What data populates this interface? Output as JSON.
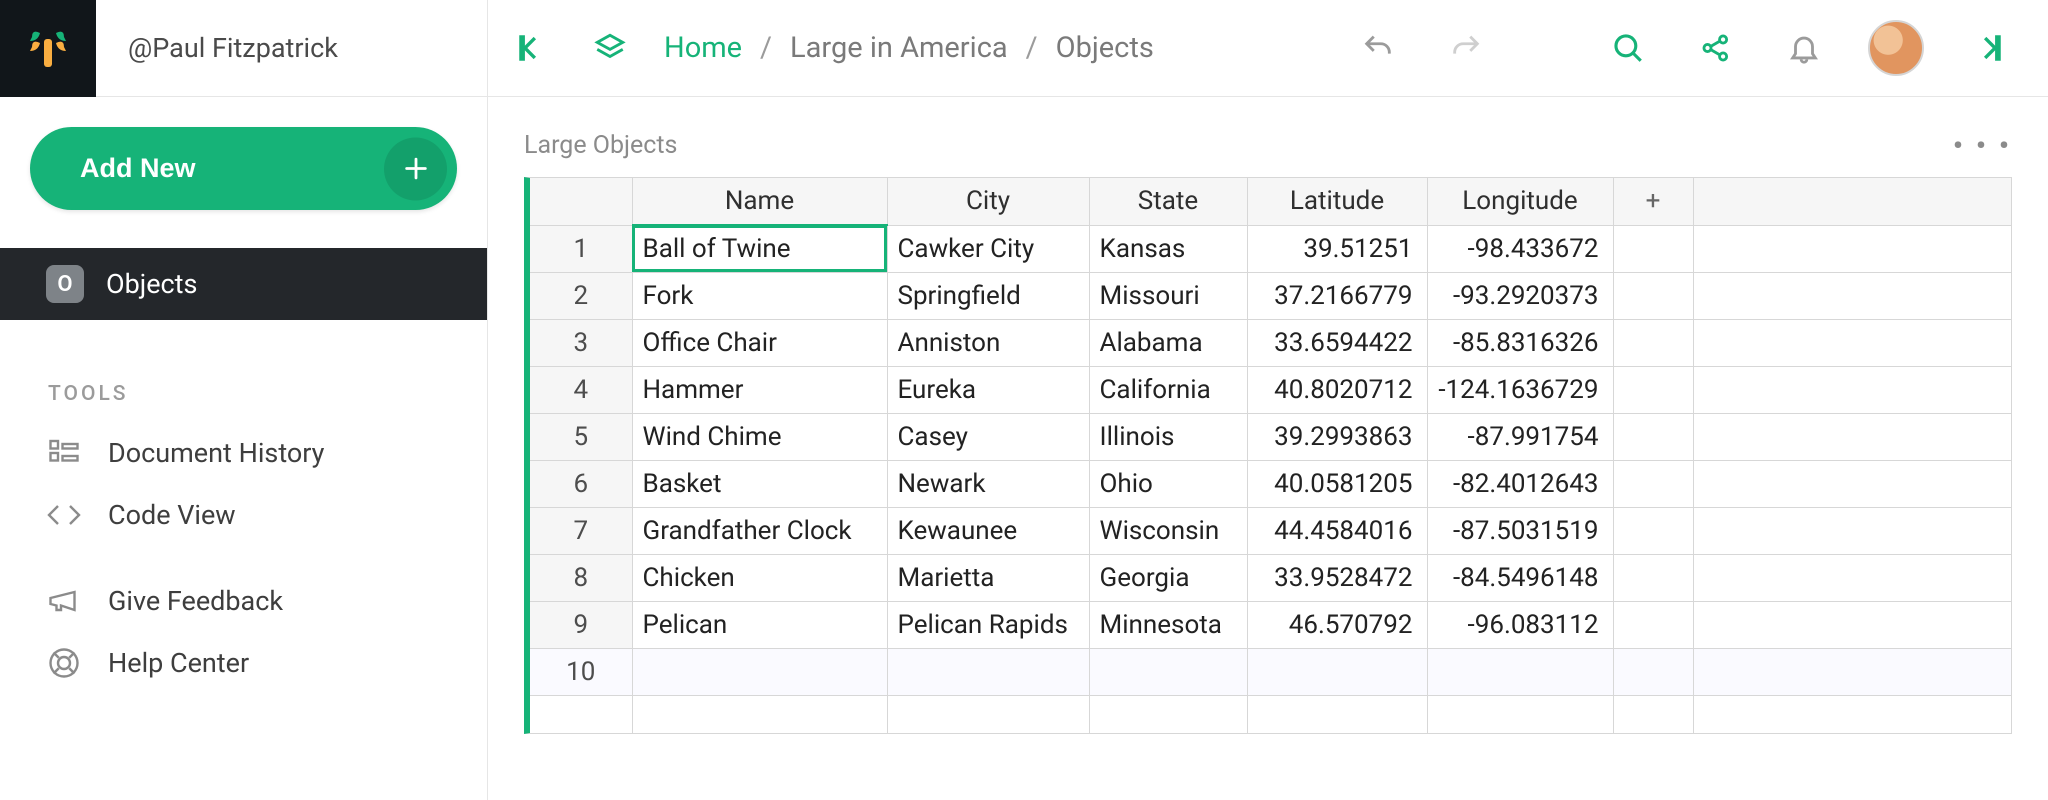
{
  "header": {
    "username_prefix": "@",
    "username": "Paul Fitzpatrick"
  },
  "sidebar": {
    "add_new_label": "Add New",
    "nav": {
      "objects_label": "Objects",
      "objects_initial": "O"
    },
    "tools_header": "TOOLS",
    "tools": {
      "doc_history": "Document History",
      "code_view": "Code View",
      "give_feedback": "Give Feedback",
      "help_center": "Help Center"
    }
  },
  "breadcrumb": {
    "home": "Home",
    "doc": "Large in America",
    "page": "Objects"
  },
  "section": {
    "title": "Large Objects",
    "more": "• • •"
  },
  "grid": {
    "columns": [
      "Name",
      "City",
      "State",
      "Latitude",
      "Longitude"
    ],
    "add_col_label": "+",
    "rows": [
      {
        "n": "1",
        "name": "Ball of Twine",
        "city": "Cawker City",
        "state": "Kansas",
        "lat": "39.51251",
        "lon": "-98.433672"
      },
      {
        "n": "2",
        "name": "Fork",
        "city": "Springfield",
        "state": "Missouri",
        "lat": "37.2166779",
        "lon": "-93.2920373"
      },
      {
        "n": "3",
        "name": "Office Chair",
        "city": "Anniston",
        "state": "Alabama",
        "lat": "33.6594422",
        "lon": "-85.8316326"
      },
      {
        "n": "4",
        "name": "Hammer",
        "city": "Eureka",
        "state": "California",
        "lat": "40.8020712",
        "lon": "-124.1636729"
      },
      {
        "n": "5",
        "name": "Wind Chime",
        "city": "Casey",
        "state": "Illinois",
        "lat": "39.2993863",
        "lon": "-87.991754"
      },
      {
        "n": "6",
        "name": "Basket",
        "city": "Newark",
        "state": "Ohio",
        "lat": "40.0581205",
        "lon": "-82.4012643"
      },
      {
        "n": "7",
        "name": "Grandfather Clock",
        "city": "Kewaunee",
        "state": "Wisconsin",
        "lat": "44.4584016",
        "lon": "-87.5031519"
      },
      {
        "n": "8",
        "name": "Chicken",
        "city": "Marietta",
        "state": "Georgia",
        "lat": "33.9528472",
        "lon": "-84.5496148"
      },
      {
        "n": "9",
        "name": "Pelican",
        "city": "Pelican Rapids",
        "state": "Minnesota",
        "lat": "46.570792",
        "lon": "-96.083112"
      }
    ],
    "new_row_n": "10"
  },
  "colors": {
    "accent": "#16b378"
  }
}
